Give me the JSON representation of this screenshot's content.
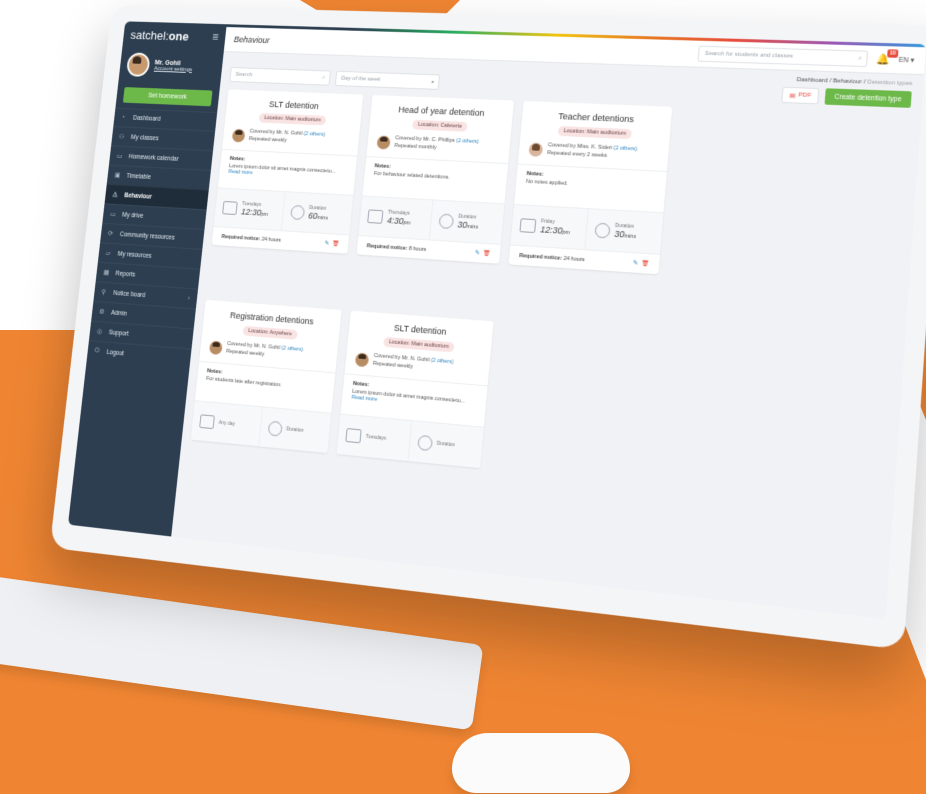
{
  "colors": {
    "orange": "#ef8532",
    "sidebar": "#2c3e50",
    "accent_green": "#6cb94a",
    "link_blue": "#2e86c1",
    "danger_red": "#e74c3c"
  },
  "app": {
    "logo_prefix": "satchel:",
    "logo_suffix": "one",
    "menu_icon": "hamburger-icon"
  },
  "profile": {
    "name": "Mr. Gohil",
    "account_link": "Account settings"
  },
  "set_homework": "Set homework",
  "nav": [
    {
      "label": "Dashboard",
      "icon": "dashboard-icon"
    },
    {
      "label": "My classes",
      "icon": "classes-icon"
    },
    {
      "label": "Homework calendar",
      "icon": "calendar-icon"
    },
    {
      "label": "Timetable",
      "icon": "timetable-icon"
    },
    {
      "label": "Behaviour",
      "icon": "warning-icon",
      "active": true
    },
    {
      "label": "My drive",
      "icon": "drive-icon"
    },
    {
      "label": "Community resources",
      "icon": "community-icon"
    },
    {
      "label": "My resources",
      "icon": "folder-icon"
    },
    {
      "label": "Reports",
      "icon": "reports-icon"
    },
    {
      "label": "Notice board",
      "icon": "pin-icon"
    },
    {
      "label": "Admin",
      "icon": "admin-icon"
    },
    {
      "label": "Support",
      "icon": "support-icon"
    },
    {
      "label": "Logout",
      "icon": "logout-icon"
    }
  ],
  "header": {
    "title": "Behaviour",
    "search_placeholder": "Search for students and classes",
    "notification_count": "10",
    "language": "EN"
  },
  "breadcrumb": {
    "items": [
      "Dashboard",
      "Behaviour"
    ],
    "current": "Detention types",
    "sep": "/"
  },
  "toolbar": {
    "search_placeholder": "Search",
    "day_placeholder": "Day of the week",
    "pdf_label": "PDF",
    "create_label": "Create detention type"
  },
  "labels": {
    "notes": "Notes:",
    "duration": "Duration",
    "required_notice": "Required notice:",
    "read_more": "Read more"
  },
  "cards": [
    {
      "title": "SLT detention",
      "location": "Location: Main auditorium",
      "covered": "Covered by Mr. N. Gohil",
      "others": "(2 others)",
      "repeat": "Repeated weekly",
      "notes": "Lorem ipsum dolor sit amet magnis consectetu...",
      "read_more": true,
      "day": "Tuesdays",
      "time": "12:30",
      "ampm": "pm",
      "duration": "60",
      "duration_unit": "mins",
      "notice": "24 hours",
      "avatar": "male"
    },
    {
      "title": "Head of year detention",
      "location": "Location: Cafeteria",
      "covered": "Covered by Mr. C. Phillips",
      "others": "(2 others)",
      "repeat": "Repeated monthly",
      "notes": "For behaviour related detentions.",
      "read_more": false,
      "day": "Thursdays",
      "time": "4:30",
      "ampm": "pm",
      "duration": "30",
      "duration_unit": "mins",
      "notice": "8 hours",
      "avatar": "male"
    },
    {
      "title": "Teacher detentions",
      "location": "Location: Main auditorium",
      "covered": "Covered by Miss. K. Sideri",
      "others": "(2 others)",
      "repeat": "Repeated every 2 weeks",
      "notes": "No notes applied.",
      "read_more": false,
      "day": "Friday",
      "time": "12:30",
      "ampm": "pm",
      "duration": "30",
      "duration_unit": "mins",
      "notice": "24 hours",
      "avatar": "female"
    },
    {
      "title": "Registration detentions",
      "location": "Location: Anywhere",
      "covered": "Covered by Mr. N. Gohil",
      "others": "(2 others)",
      "repeat": "Repeated weekly",
      "notes": "For students late after registration.",
      "read_more": false,
      "day": "Any day",
      "time": "",
      "ampm": "",
      "duration": "",
      "duration_unit": "",
      "notice": "",
      "avatar": "male"
    },
    {
      "title": "SLT detention",
      "location": "Location: Main auditorium",
      "covered": "Covered by Mr. N. Gohil",
      "others": "(2 others)",
      "repeat": "Repeated weekly",
      "notes": "Lorem ipsum dolor sit amet magnis consectetu...",
      "read_more": true,
      "day": "Tuesdays",
      "time": "",
      "ampm": "",
      "duration": "",
      "duration_unit": "",
      "notice": "",
      "avatar": "male"
    }
  ]
}
